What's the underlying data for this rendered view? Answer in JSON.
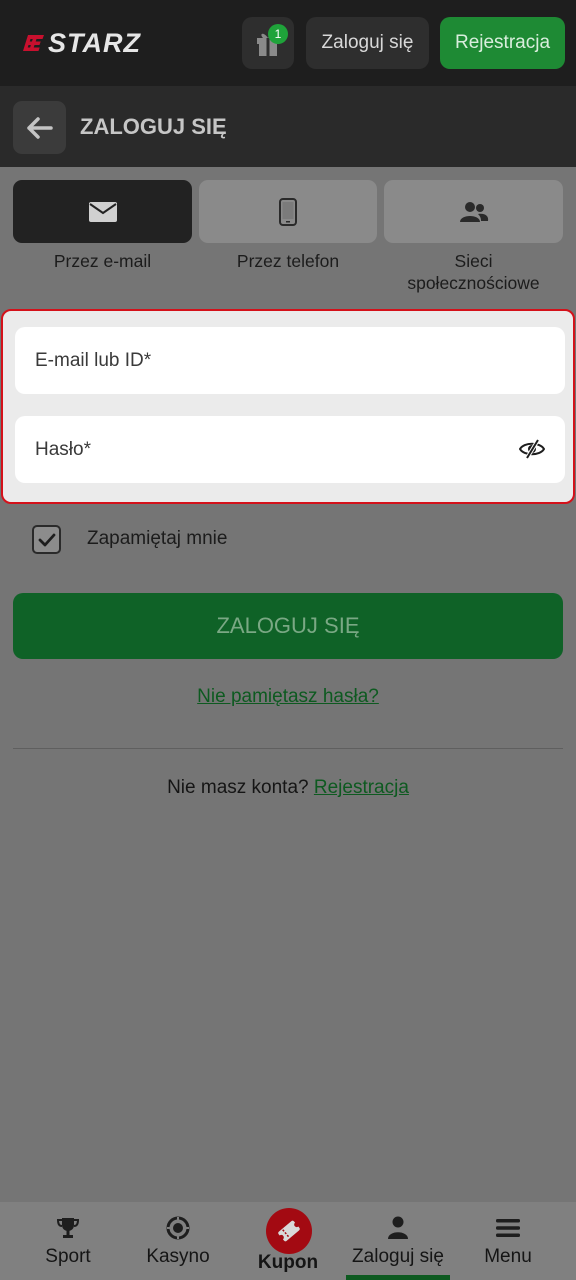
{
  "header": {
    "logo_text": "STARZ",
    "gift_badge": "1",
    "login_label": "Zaloguj się",
    "register_label": "Rejestracja"
  },
  "subheader": {
    "title": "ZALOGUJ SIĘ"
  },
  "tabs": [
    {
      "label": "Przez e-mail",
      "icon": "envelope-icon",
      "active": true
    },
    {
      "label": "Przez telefon",
      "icon": "phone-icon",
      "active": false
    },
    {
      "label": "Sieci społecznościowe",
      "icon": "users-icon",
      "active": false
    }
  ],
  "form": {
    "email_placeholder": "E-mail lub ID*",
    "password_placeholder": "Hasło*",
    "remember_label": "Zapamiętaj mnie",
    "remember_checked": true,
    "submit_label": "ZALOGUJ SIĘ",
    "forgot_label": "Nie pamiętasz hasła?",
    "no_account_text": "Nie masz konta?",
    "register_link": "Rejestracja"
  },
  "bottom_nav": [
    {
      "label": "Sport",
      "icon": "trophy-icon"
    },
    {
      "label": "Kasyno",
      "icon": "casino-chip-icon"
    },
    {
      "label": "Kupon",
      "icon": "ticket-icon"
    },
    {
      "label": "Zaloguj się",
      "icon": "user-icon",
      "active": true
    },
    {
      "label": "Menu",
      "icon": "hamburger-icon"
    }
  ],
  "colors": {
    "accent_green": "#1e8a34",
    "highlight_red": "#d4111a",
    "dark_bg": "#1e1e1e"
  }
}
